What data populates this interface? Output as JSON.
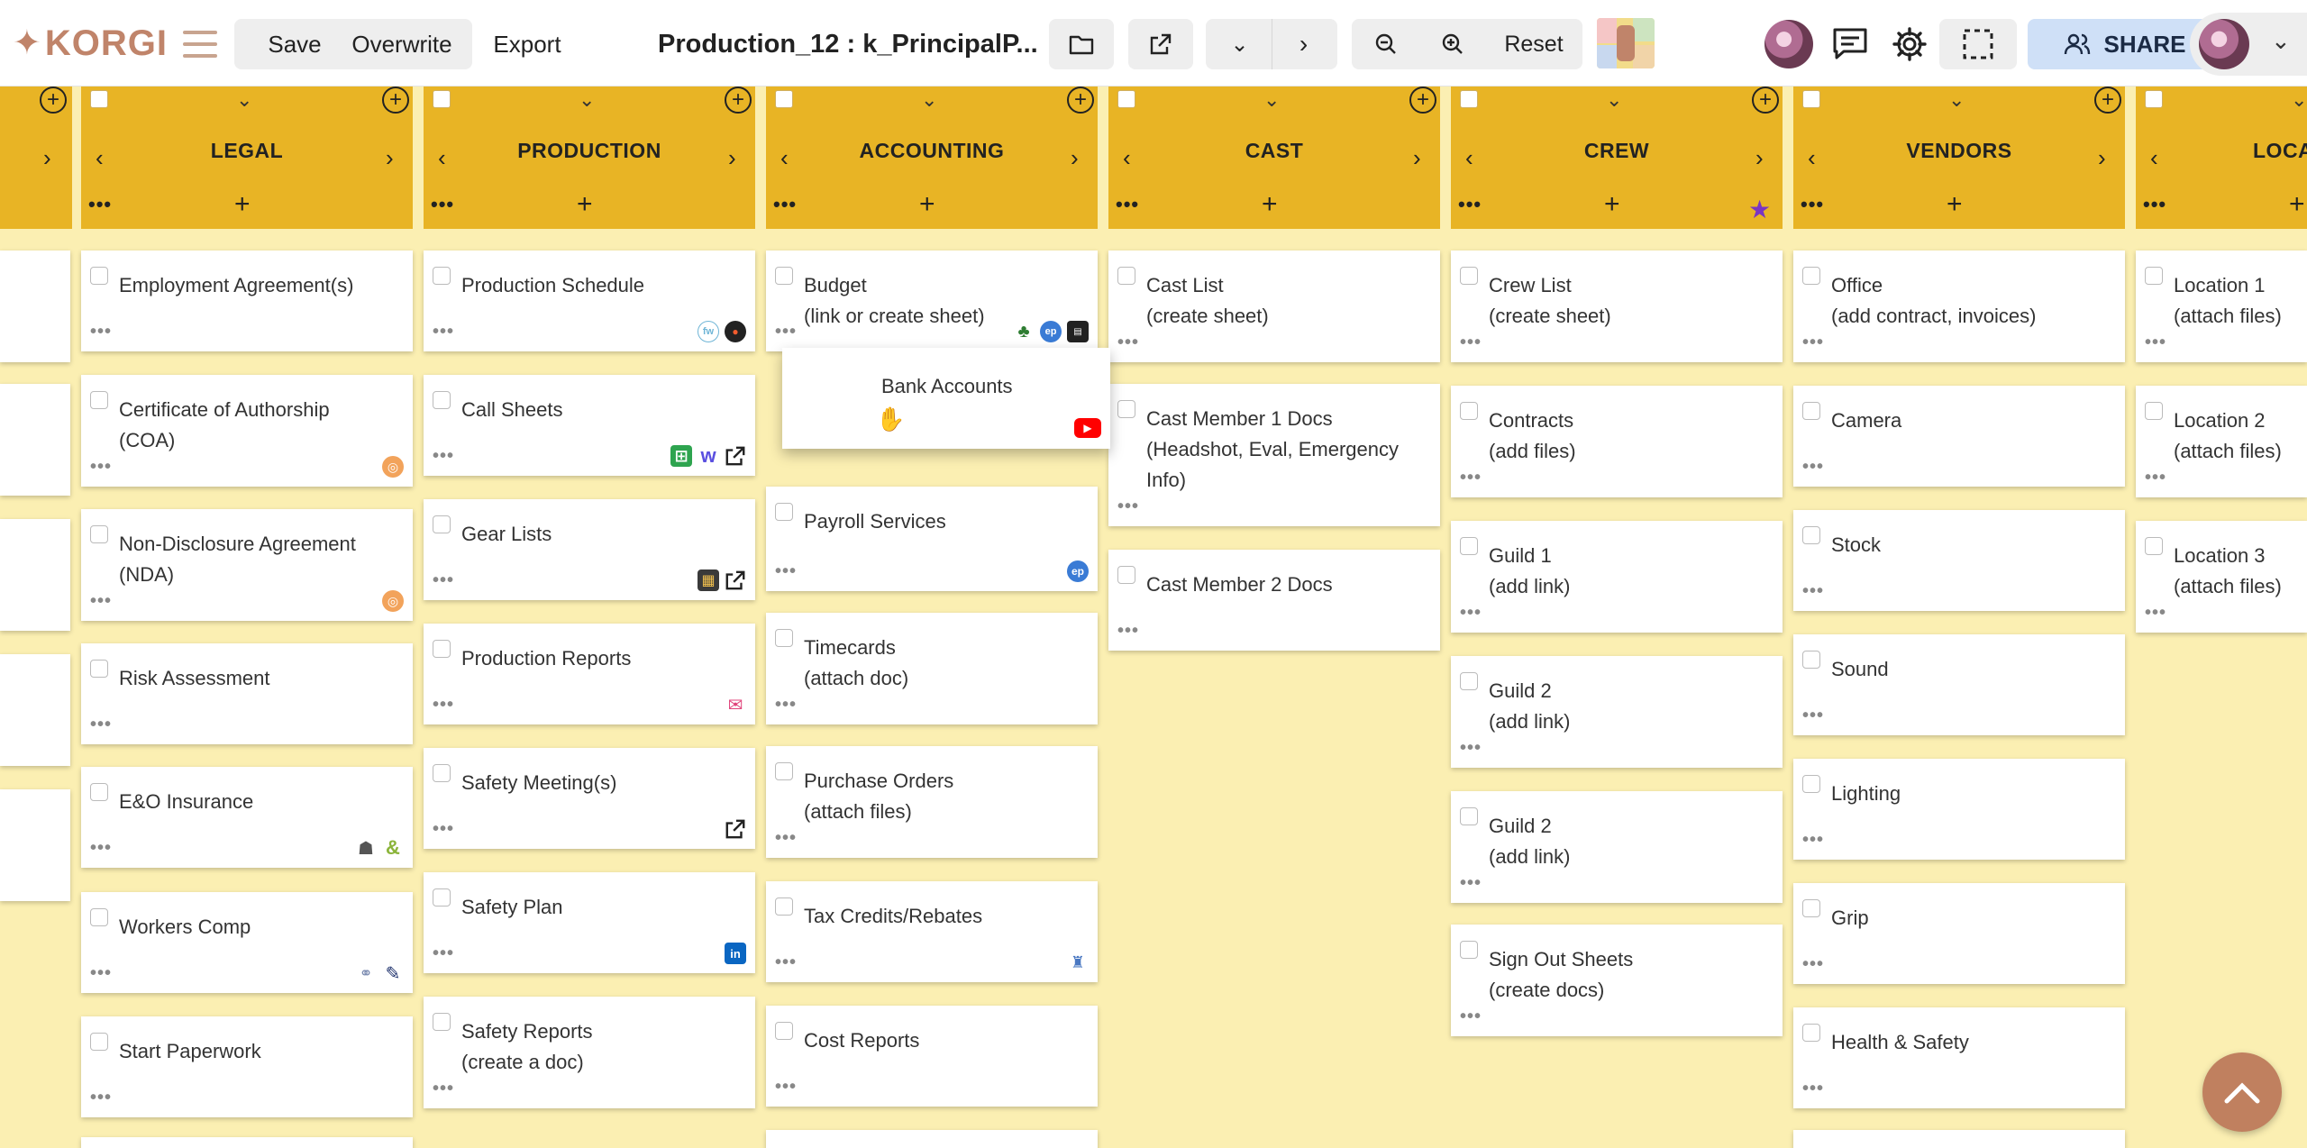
{
  "toolbar": {
    "logo_text": "KORGI",
    "save": "Save",
    "overwrite": "Overwrite",
    "export": "Export",
    "title": "Production_12 : k_PrincipalP...",
    "reset": "Reset",
    "share": "SHARE"
  },
  "columns": [
    {
      "title": "",
      "cards": [
        {
          "text": ""
        },
        {
          "text": ""
        },
        {
          "text": ""
        },
        {
          "text": ""
        },
        {
          "text": ""
        }
      ]
    },
    {
      "title": "LEGAL",
      "cards": [
        {
          "text": "Employment Agreement(s)"
        },
        {
          "text": "Certificate of Authorship\n(COA)"
        },
        {
          "text": "Non-Disclosure Agreement\n(NDA)"
        },
        {
          "text": "Risk Assessment"
        },
        {
          "text": "E&O Insurance"
        },
        {
          "text": "Workers Comp"
        },
        {
          "text": "Start Paperwork"
        }
      ]
    },
    {
      "title": "PRODUCTION",
      "cards": [
        {
          "text": "Production Schedule"
        },
        {
          "text": "Call Sheets"
        },
        {
          "text": "Gear Lists"
        },
        {
          "text": "Production Reports"
        },
        {
          "text": "Safety Meeting(s)"
        },
        {
          "text": "Safety Plan"
        },
        {
          "text": "Safety Reports\n(create a doc)"
        }
      ]
    },
    {
      "title": "ACCOUNTING",
      "cards": [
        {
          "text": "Budget\n(link or create sheet)"
        },
        {
          "text": "Payroll Services"
        },
        {
          "text": "Timecards\n(attach doc)"
        },
        {
          "text": "Purchase Orders\n(attach files)"
        },
        {
          "text": "Tax Credits/Rebates"
        },
        {
          "text": "Cost Reports"
        }
      ]
    },
    {
      "title": "CAST",
      "cards": [
        {
          "text": "Cast List\n(create sheet)"
        },
        {
          "text": "Cast Member 1 Docs\n(Headshot, Eval, Emergency\nInfo)"
        },
        {
          "text": "Cast Member 2 Docs"
        }
      ]
    },
    {
      "title": "CREW",
      "cards": [
        {
          "text": "Crew List\n(create sheet)"
        },
        {
          "text": "Contracts\n(add files)"
        },
        {
          "text": "Guild 1\n(add link)"
        },
        {
          "text": "Guild 2\n(add link)"
        },
        {
          "text": "Guild 2\n(add link)"
        },
        {
          "text": "Sign Out Sheets\n(create docs)"
        }
      ]
    },
    {
      "title": "VENDORS",
      "cards": [
        {
          "text": "Office\n(add contract, invoices)"
        },
        {
          "text": "Camera"
        },
        {
          "text": "Stock"
        },
        {
          "text": "Sound"
        },
        {
          "text": "Lighting"
        },
        {
          "text": "Grip"
        },
        {
          "text": "Health & Safety"
        }
      ]
    },
    {
      "title": "LOCAT",
      "cards": [
        {
          "text": "Location 1\n(attach files)"
        },
        {
          "text": "Location 2\n(attach files)"
        },
        {
          "text": "Location 3\n(attach files)"
        }
      ]
    }
  ],
  "dragging_card": {
    "text": "Bank Accounts"
  },
  "colors": {
    "header_gold": "#e8b425",
    "board_background": "#fbefb2",
    "share_button": "#cfe0f7",
    "brand": "#c0846a"
  }
}
